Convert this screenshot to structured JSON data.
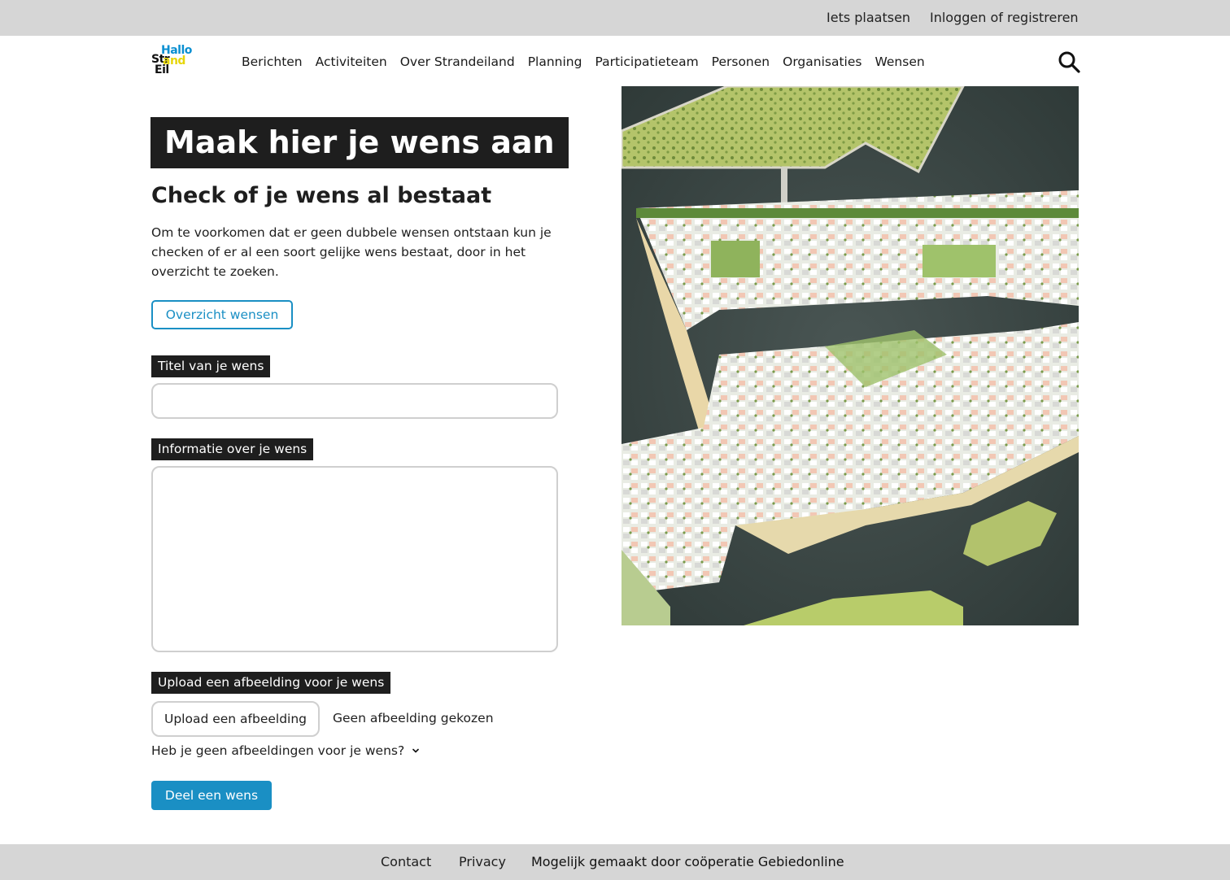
{
  "topbar": {
    "post_label": "Iets plaatsen",
    "login_label": "Inloggen of registreren"
  },
  "header": {
    "logo": {
      "line1": "Hallo",
      "line2a": "Str",
      "line2b": "and",
      "line3": "Eil"
    },
    "nav": [
      "Berichten",
      "Activiteiten",
      "Over Strandeiland",
      "Planning",
      "Participatieteam",
      "Personen",
      "Organisaties",
      "Wensen"
    ],
    "search_icon": "search-icon"
  },
  "main": {
    "title": "Maak hier je wens aan",
    "subtitle": "Check of je wens al bestaat",
    "intro": "Om te voorkomen dat er geen dubbele wensen ontstaan kun je checken of er al een soort gelijke wens bestaat, door in het overzicht te zoeken.",
    "overview_button": "Overzicht wensen",
    "form": {
      "title_label": "Titel van je wens",
      "title_value": "",
      "info_label": "Informatie over je wens",
      "info_value": "",
      "upload_label": "Upload een afbeelding voor je wens",
      "upload_button": "Upload een afbeelding",
      "upload_status": "Geen afbeelding gekozen",
      "no_images_toggle": "Heb je geen afbeeldingen voor je wens?",
      "submit_button": "Deel een wens"
    }
  },
  "footer": {
    "contact": "Contact",
    "privacy": "Privacy",
    "credit": "Mogelijk gemaakt door coöperatie Gebiedonline"
  },
  "colors": {
    "accent": "#1a8fc4",
    "dark": "#1e1e1e",
    "bar": "#d6d6d6"
  }
}
